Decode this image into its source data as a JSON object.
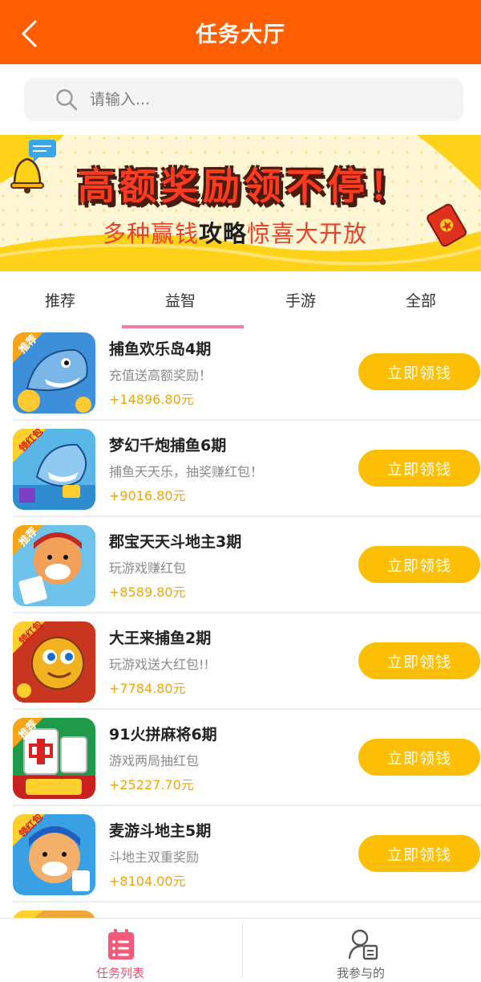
{
  "header": {
    "title": "任务大厅"
  },
  "search": {
    "placeholder": "请输入..."
  },
  "banner": {
    "title": "高额奖励领不停！",
    "subtitle_pre": "多种赢钱",
    "subtitle_em": "攻略",
    "subtitle_post": "惊喜大开放"
  },
  "tabs": [
    {
      "label": "推荐",
      "active": false
    },
    {
      "label": "益智",
      "active": true
    },
    {
      "label": "手游",
      "active": false
    },
    {
      "label": "全部",
      "active": false
    }
  ],
  "tasks": [
    {
      "title": "捕鱼欢乐岛4期",
      "desc": "充值送高额奖励！",
      "amount": "+14896.80元",
      "button": "立即领钱",
      "badge": "推荐"
    },
    {
      "title": "梦幻千炮捕鱼6期",
      "desc": "捕鱼天天乐，抽奖赚红包！",
      "amount": "+9016.80元",
      "button": "立即领钱",
      "badge": "领红包"
    },
    {
      "title": "郡宝天天斗地主3期",
      "desc": "玩游戏赚红包",
      "amount": "+8589.80元",
      "button": "立即领钱",
      "badge": "推荐"
    },
    {
      "title": "大王来捕鱼2期",
      "desc": "玩游戏送大红包!!",
      "amount": "+7784.80元",
      "button": "立即领钱",
      "badge": "领红包"
    },
    {
      "title": "91火拼麻将6期",
      "desc": "游戏两局抽红包",
      "amount": "+25227.70元",
      "button": "立即领钱",
      "badge": "推荐"
    },
    {
      "title": "麦游斗地主5期",
      "desc": "斗地主双重奖励",
      "amount": "+8104.00元",
      "button": "立即领钱",
      "badge": "领红包"
    }
  ],
  "bottom_nav": [
    {
      "label": "任务列表",
      "active": true,
      "icon": "task-list-icon"
    },
    {
      "label": "我参与的",
      "active": false,
      "icon": "user-participation-icon"
    }
  ],
  "colors": {
    "header": "#ff5f00",
    "button": "#fdbf06",
    "amount": "#f2a500",
    "tab_indicator": "#f07ea0",
    "nav_active": "#f04f6d"
  }
}
